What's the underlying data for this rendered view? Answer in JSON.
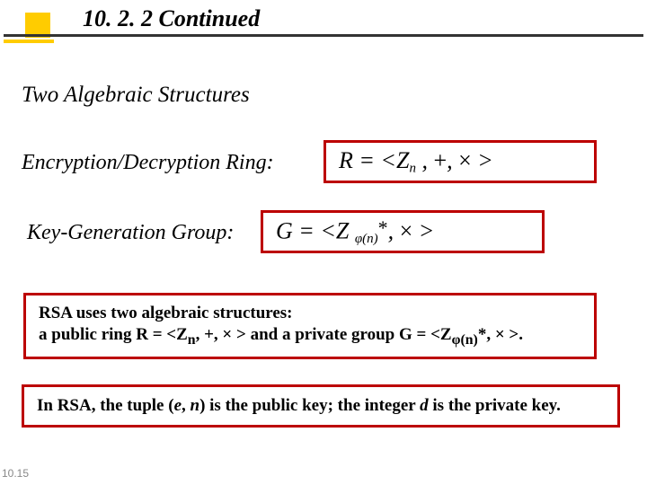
{
  "header": {
    "title": "10. 2. 2  Continued"
  },
  "subhead": "Two Algebraic Structures",
  "rows": {
    "ring_label": "Encryption/Decryption Ring:",
    "group_label": "Key-Generation Group:"
  },
  "formulas": {
    "R_prefix": "R = <Z",
    "R_sub": "n",
    "R_suffix_a": " , ",
    "R_plus": "+",
    "R_comma": ", ",
    "R_times": "×",
    "R_close": " >",
    "G_prefix": "G = <Z ",
    "G_sub": "φ(n)",
    "G_star": "*",
    "G_mid": ", ",
    "G_times": "×",
    "G_close": " >"
  },
  "notes": {
    "line1a": "RSA uses two algebraic structures:",
    "line1b_a": "a public ring R = <Z",
    "line1b_sub1": "n",
    "line1b_b": ", +, × > and a private group G = <Z",
    "line1b_sub2": "φ(n)",
    "line1b_c": "*, × >.",
    "line2_a": "In RSA, the tuple (",
    "line2_e": "e",
    "line2_b": ", ",
    "line2_n": "n",
    "line2_c": ") is the public key; the integer ",
    "line2_d": "d",
    "line2_e2": " is the private key."
  },
  "slide_number": "10.15"
}
